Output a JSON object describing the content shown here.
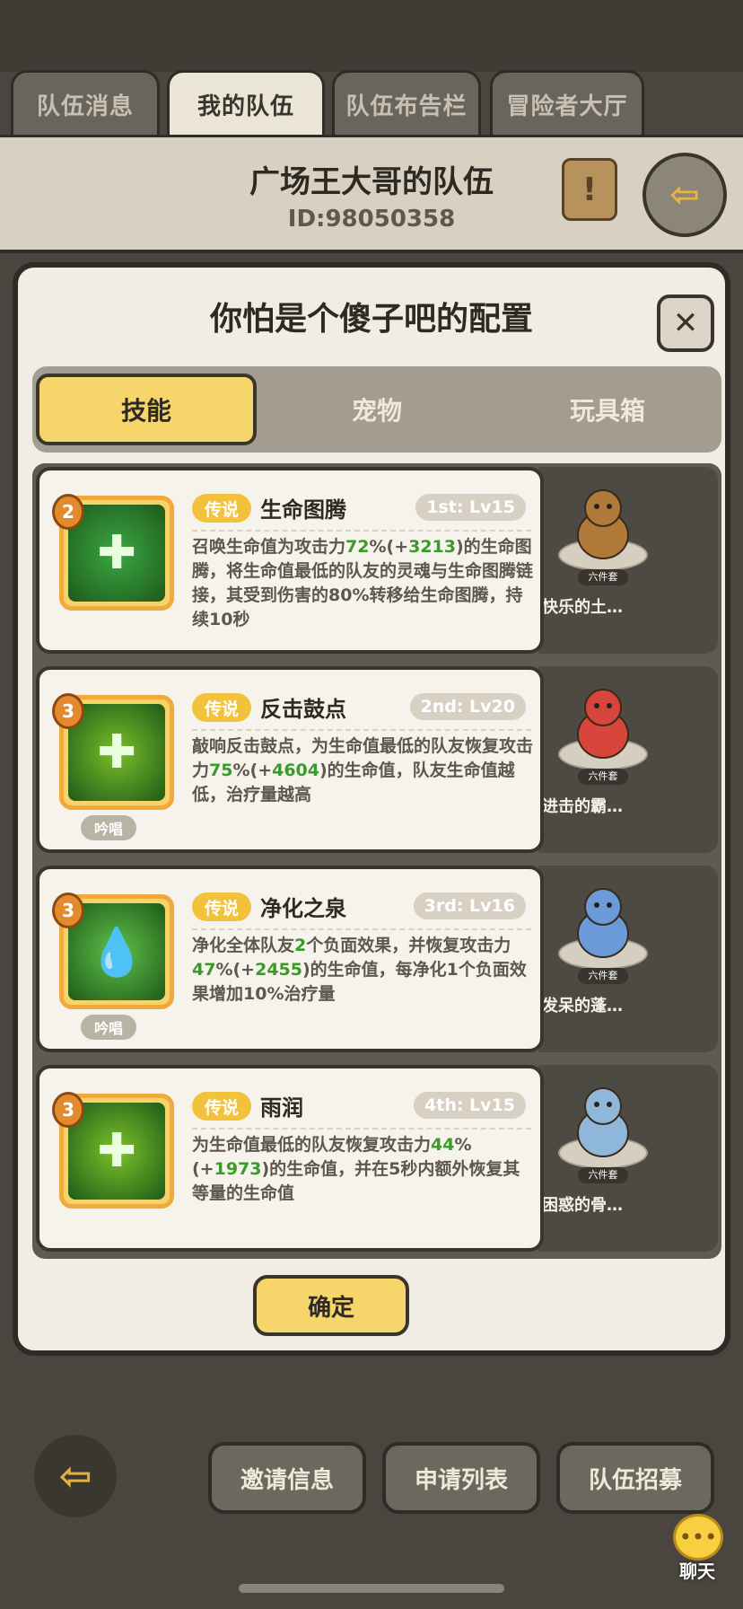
{
  "tabs": [
    {
      "label": "队伍消息"
    },
    {
      "label": "我的队伍"
    },
    {
      "label": "队伍布告栏"
    },
    {
      "label": "冒险者大厅"
    }
  ],
  "team": {
    "name": "广场王大哥的队伍",
    "id": "ID:98050358",
    "notice_glyph": "!",
    "exit_glyph": "⇦"
  },
  "modal": {
    "title": "你怕是个傻子吧的配置",
    "close_glyph": "✕",
    "subtabs": [
      {
        "label": "技能"
      },
      {
        "label": "宠物"
      },
      {
        "label": "玩具箱"
      }
    ],
    "confirm_label": "确定"
  },
  "skills": [
    {
      "rank": "2",
      "badge": "传说",
      "name": "生命图腾",
      "level": "1st: Lv15",
      "chant": "",
      "icon": "totem-icon",
      "icon_color": "#3aa845",
      "desc": {
        "t1": "召唤生命值为攻击力",
        "g1": "72",
        "t2": "%(+",
        "g2": "3213",
        "t3": ")的生命图腾，将生命值最低的队友的灵魂与生命图腾链接，其受到伤害的80%转移给生命图腾，持续10秒"
      },
      "pet": {
        "name": "快乐的土…",
        "tag": "六件套",
        "color": "#b07a3a"
      }
    },
    {
      "rank": "3",
      "badge": "传说",
      "name": "反击鼓点",
      "level": "2nd: Lv20",
      "chant": "吟唱",
      "icon": "drum-icon",
      "icon_color": "#7abf2a",
      "desc": {
        "t1": "敲响反击鼓点，为生命值最低的队友恢复攻击力",
        "g1": "75",
        "t2": "%(+",
        "g2": "4604",
        "t3": ")的生命值，队友生命值越低，治疗量越高"
      },
      "pet": {
        "name": "进击的霸…",
        "tag": "六件套",
        "color": "#d8453a"
      }
    },
    {
      "rank": "3",
      "badge": "传说",
      "name": "净化之泉",
      "level": "3rd: Lv16",
      "chant": "吟唱",
      "icon": "spring-drop-icon",
      "icon_color": "#5fc24a",
      "desc": {
        "t1": "净化全体队友",
        "g1": "2",
        "t2": "个负面效果，并恢复攻击力",
        "g2": "47",
        "t3": "%(+",
        "g3": "2455",
        "t4": ")的生命值，每净化1个负面效果增加10%治疗量"
      },
      "pet": {
        "name": "发呆的蓬…",
        "tag": "六件套",
        "color": "#6a9ad8"
      }
    },
    {
      "rank": "3",
      "badge": "传说",
      "name": "雨润",
      "level": "4th: Lv15",
      "chant": "",
      "icon": "heal-cross-icon",
      "icon_color": "#7cc22a",
      "desc": {
        "t1": "为生命值最低的队友恢复攻击力",
        "g1": "44",
        "t2": "%(+",
        "g2": "1973",
        "t3": ")的生命值，并在5秒内额外恢复其等量的生命值"
      },
      "pet": {
        "name": "困惑的骨…",
        "tag": "六件套",
        "color": "#8fb7d9"
      }
    }
  ],
  "bottom": {
    "back_glyph": "⇦",
    "buttons": [
      {
        "label": "邀请信息"
      },
      {
        "label": "申请列表"
      },
      {
        "label": "队伍招募"
      }
    ],
    "chat_label": "聊天",
    "chat_glyph": "•••"
  }
}
